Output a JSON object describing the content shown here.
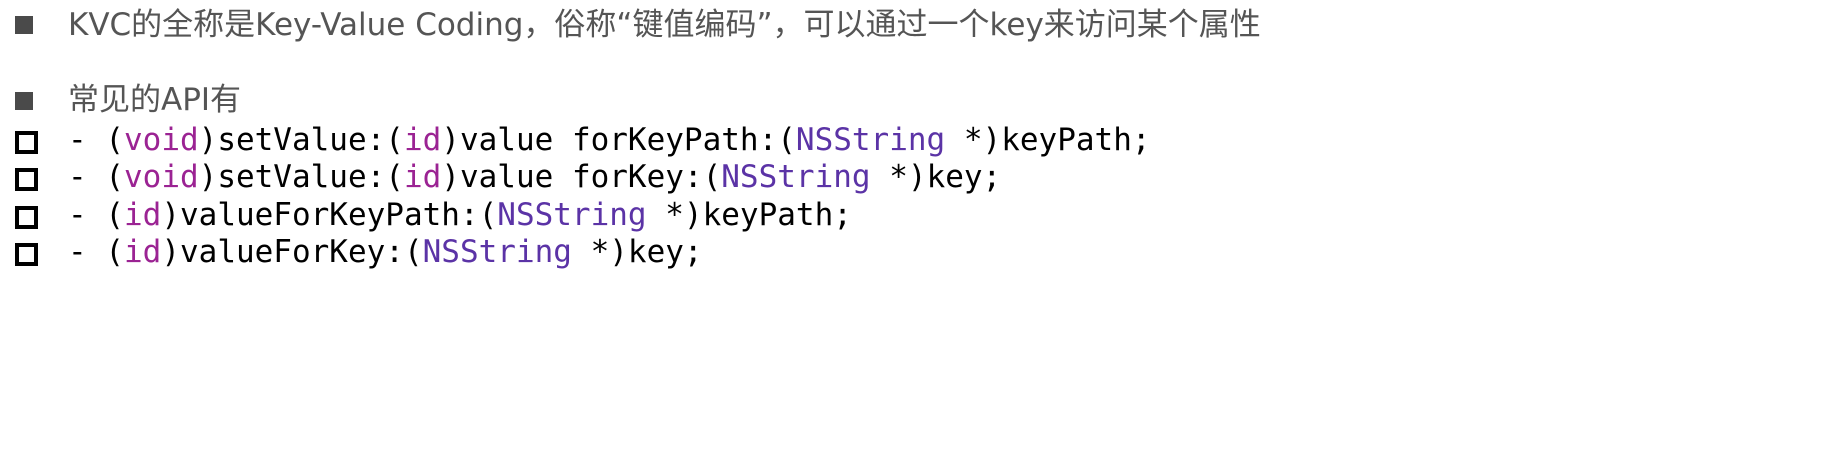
{
  "colors": {
    "text_gray": "#555555",
    "bullet_gray": "#4a4a4a",
    "keyword": "#9b2393",
    "class_name": "#5b33a6",
    "code_text": "#000000"
  },
  "intro": {
    "text": "KVC的全称是Key-Value Coding，俗称“键值编码”，可以通过一个key来访问某个属性"
  },
  "api_heading": {
    "text": "常见的API有"
  },
  "api_methods": [
    {
      "prefix": "- (",
      "return_type": "void",
      "part1": ")setValue:(",
      "arg1_type": "id",
      "part2": ")value forKeyPath:(",
      "arg2_type": "NSString",
      "part3": " *)keyPath;"
    },
    {
      "prefix": "- (",
      "return_type": "void",
      "part1": ")setValue:(",
      "arg1_type": "id",
      "part2": ")value forKey:(",
      "arg2_type": "NSString",
      "part3": " *)key;"
    },
    {
      "prefix": "- (",
      "return_type": "id",
      "part1": ")valueForKeyPath:(",
      "arg2_type": "NSString",
      "part3": " *)keyPath;"
    },
    {
      "prefix": "- (",
      "return_type": "id",
      "part1": ")valueForKey:(",
      "arg2_type": "NSString",
      "part3": " *)key;"
    }
  ]
}
